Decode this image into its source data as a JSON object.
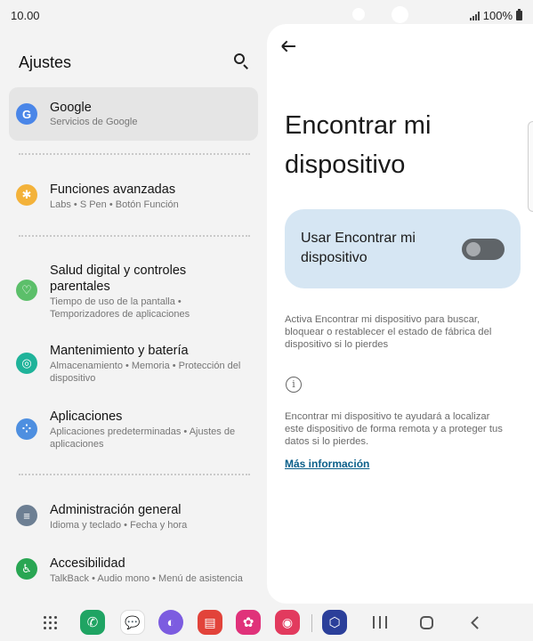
{
  "status_bar": {
    "time": "10.00",
    "battery": "100%"
  },
  "left_panel": {
    "title": "Ajustes",
    "items": [
      {
        "title": "Google",
        "subtitle": "Servicios de Google",
        "icon": "google-g-icon",
        "color": "#4a86e8",
        "glyph": "G"
      },
      {
        "title": "Funciones avanzadas",
        "subtitle": "Labs  •  S Pen  •  Botón Función",
        "icon": "advanced-features-icon",
        "color": "#f3b23a",
        "glyph": "✱"
      },
      {
        "title": "Salud digital y controles parentales",
        "subtitle": "Tiempo de uso de la pantalla  •  Temporizadores de aplicaciones",
        "icon": "digital-wellbeing-icon",
        "color": "#5cbf6a",
        "glyph": "♡"
      },
      {
        "title": "Mantenimiento y batería",
        "subtitle": "Almacenamiento  •  Memoria  •  Protección del dispositivo",
        "icon": "device-care-icon",
        "color": "#1fb39a",
        "glyph": "◎"
      },
      {
        "title": "Aplicaciones",
        "subtitle": "Aplicaciones predeterminadas  •  Ajustes de aplicaciones",
        "icon": "apps-icon",
        "color": "#4e8fe0",
        "glyph": "⁘"
      },
      {
        "title": "Administración general",
        "subtitle": "Idioma y teclado  •  Fecha y hora",
        "icon": "general-management-icon",
        "color": "#6d7f93",
        "glyph": "≡"
      },
      {
        "title": "Accesibilidad",
        "subtitle": "TalkBack  •  Audio mono  •  Menú de asistencia",
        "icon": "accessibility-icon",
        "color": "#29a653",
        "glyph": "♿"
      }
    ]
  },
  "detail": {
    "title": "Encontrar mi dispositivo",
    "toggle_label": "Usar Encontrar mi dispositivo",
    "toggle_on": false,
    "description": "Activa Encontrar mi dispositivo para buscar, bloquear o restablecer el estado de fábrica del dispositivo si lo pierdes",
    "info_text": "Encontrar mi dispositivo te ayudará a localizar este dispositivo de forma remota y a proteger tus datos si lo pierdes.",
    "link": "Más información"
  },
  "dock": {
    "apps": [
      {
        "name": "phone-icon",
        "color": "#1fa463",
        "glyph": "✆"
      },
      {
        "name": "messages-icon",
        "color": "#1b6fd8",
        "glyph": "💬"
      },
      {
        "name": "internet-icon",
        "color": "#7c5ce0",
        "glyph": "◐"
      },
      {
        "name": "notes-icon",
        "color": "#e2433a",
        "glyph": "▤"
      },
      {
        "name": "gallery-icon",
        "color": "#e0327a",
        "glyph": "✿"
      },
      {
        "name": "camera-icon",
        "color": "#e23a5e",
        "glyph": "◉"
      },
      {
        "name": "security-icon",
        "color": "#2b3f9a",
        "glyph": "⬡"
      }
    ]
  }
}
